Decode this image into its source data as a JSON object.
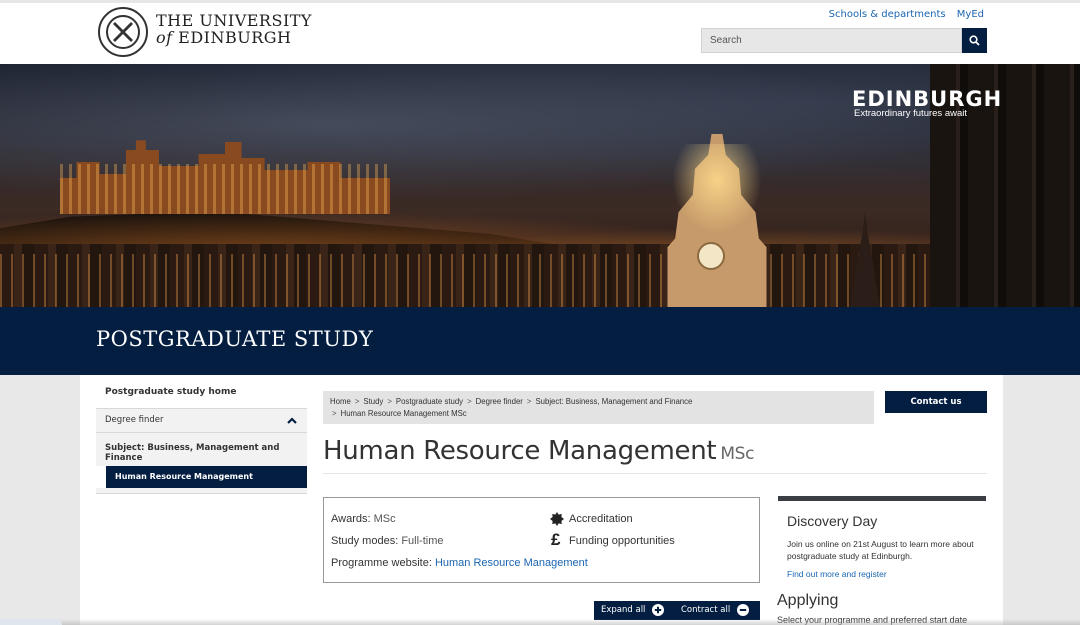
{
  "header": {
    "logo_line1": "THE UNIVERSITY",
    "logo_line2_of": "of",
    "logo_line2_name": "EDINBURGH",
    "seal_icon": "university-seal-icon",
    "top_links": [
      "Schools & departments",
      "MyEd"
    ],
    "search_placeholder": "Search",
    "search_icon": "search-icon"
  },
  "hero": {
    "brand_name": "EDINBURGH",
    "brand_tagline": "Extraordinary futures await"
  },
  "band": {
    "title": "POSTGRADUATE STUDY"
  },
  "sidebar": {
    "home": "Postgraduate study home",
    "degree_finder": "Degree finder",
    "subject": "Subject: Business, Management and Finance",
    "active": "Human Resource Management"
  },
  "breadcrumb": {
    "items": [
      "Home",
      "Study",
      "Postgraduate study",
      "Degree finder",
      "Subject: Business, Management and Finance",
      "Human Resource Management MSc"
    ],
    "separator": ">"
  },
  "contact_button": "Contact us",
  "page": {
    "title": "Human Resource Management",
    "award": "MSc"
  },
  "facts": {
    "awards_label": "Awards:",
    "awards_value": "MSc",
    "modes_label": "Study modes:",
    "modes_value": "Full-time",
    "website_label": "Programme website:",
    "website_value": "Human Resource Management",
    "accreditation": "Accreditation",
    "funding": "Funding opportunities",
    "funding_symbol": "£"
  },
  "discovery": {
    "title": "Discovery Day",
    "body": "Join us online on 21st August to learn more about postgraduate study at Edinburgh.",
    "link": "Find out more and register"
  },
  "expand": {
    "expand_all": "Expand all",
    "contract_all": "Contract all"
  },
  "applying": {
    "title": "Applying",
    "body": "Select your programme and preferred start date"
  },
  "colors": {
    "navy": "#041e42",
    "link": "#1b66b1"
  }
}
